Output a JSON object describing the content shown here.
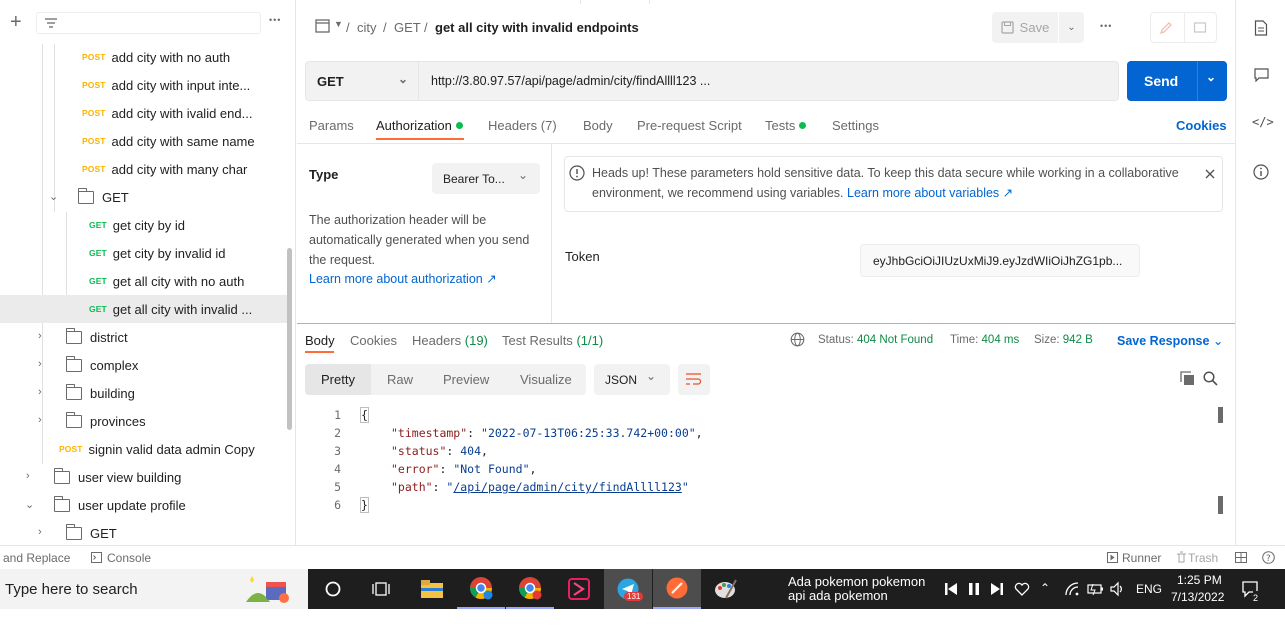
{
  "sidebar": {
    "add_label": "+",
    "more_label": "•••",
    "items": [
      {
        "method": "POST",
        "label": "add city with no auth"
      },
      {
        "method": "POST",
        "label": "add city with input inte..."
      },
      {
        "method": "POST",
        "label": "add city with ivalid end..."
      },
      {
        "method": "POST",
        "label": "add city with same name"
      },
      {
        "method": "POST",
        "label": "add city with many char"
      },
      {
        "folder": "GET"
      },
      {
        "method": "GET",
        "label": "get city by id"
      },
      {
        "method": "GET",
        "label": "get city by invalid id"
      },
      {
        "method": "GET",
        "label": "get all city with no auth"
      },
      {
        "method": "GET",
        "label": "get all city with invalid ..."
      },
      {
        "folder": "district"
      },
      {
        "folder": "complex"
      },
      {
        "folder": "building"
      },
      {
        "folder": "provinces"
      },
      {
        "method": "POST",
        "label": "signin valid data admin Copy"
      },
      {
        "folder": "user view building"
      },
      {
        "folder": "user update profile"
      },
      {
        "folder": "GET"
      }
    ]
  },
  "breadcrumb": {
    "seg1": "city",
    "seg2": "GET",
    "current": "get all city with invalid endpoints"
  },
  "toolbar": {
    "save_label": "Save",
    "more_label": "•••"
  },
  "request": {
    "method": "GET",
    "url": "http://3.80.97.57/api/page/admin/city/findAllll123 ...",
    "send_label": "Send"
  },
  "req_tabs": {
    "params": "Params",
    "authorization": "Authorization",
    "headers": "Headers",
    "headers_count": "(7)",
    "body": "Body",
    "prerequest": "Pre-request Script",
    "tests": "Tests",
    "settings": "Settings",
    "cookies": "Cookies"
  },
  "auth": {
    "type_label": "Type",
    "type_value": "Bearer To...",
    "description": "The authorization header will be automatically generated when you send the request.",
    "learn_more": "Learn more about authorization ↗",
    "alert_text": "Heads up! These parameters hold sensitive data. To keep this data secure while working in a collaborative environment, we recommend using variables.",
    "alert_link": "Learn more about variables ↗",
    "token_label": "Token",
    "token_value": "eyJhbGciOiJIUzUxMiJ9.eyJzdWIiOiJhZG1pb..."
  },
  "response": {
    "tabs": {
      "body": "Body",
      "cookies": "Cookies",
      "headers": "Headers",
      "headers_count": "(19)",
      "test_results": "Test Results",
      "test_results_count": "(1/1)"
    },
    "status_label": "Status:",
    "status_value": "404 Not Found",
    "time_label": "Time:",
    "time_value": "404 ms",
    "size_label": "Size:",
    "size_value": "942 B",
    "save_response": "Save Response",
    "views": {
      "pretty": "Pretty",
      "raw": "Raw",
      "preview": "Preview",
      "visualize": "Visualize"
    },
    "format": "JSON",
    "lines": [
      {
        "n": "1",
        "text": "{"
      },
      {
        "n": "2",
        "key": "\"timestamp\"",
        "value": "\"2022-07-13T06:25:33.742+00:00\"",
        "tail": ","
      },
      {
        "n": "3",
        "key": "\"status\"",
        "value": "404",
        "tail": ","
      },
      {
        "n": "4",
        "key": "\"error\"",
        "value": "\"Not Found\"",
        "tail": ","
      },
      {
        "n": "5",
        "key": "\"path\"",
        "q1": "\"",
        "link": "/api/page/admin/city/findAllll123",
        "q2": "\""
      },
      {
        "n": "6",
        "text": "}"
      }
    ]
  },
  "statusbar": {
    "find_replace": "and Replace",
    "console": "Console",
    "runner": "Runner",
    "trash": "Trash"
  },
  "taskbar": {
    "search_placeholder": "Type here to search",
    "telegram_badge": "131",
    "media_title": "Ada pokemon pokemon",
    "media_subtitle": "api ada pokemon",
    "language": "ENG",
    "time": "1:25 PM",
    "date": "7/13/2022",
    "notif_count": "2"
  }
}
